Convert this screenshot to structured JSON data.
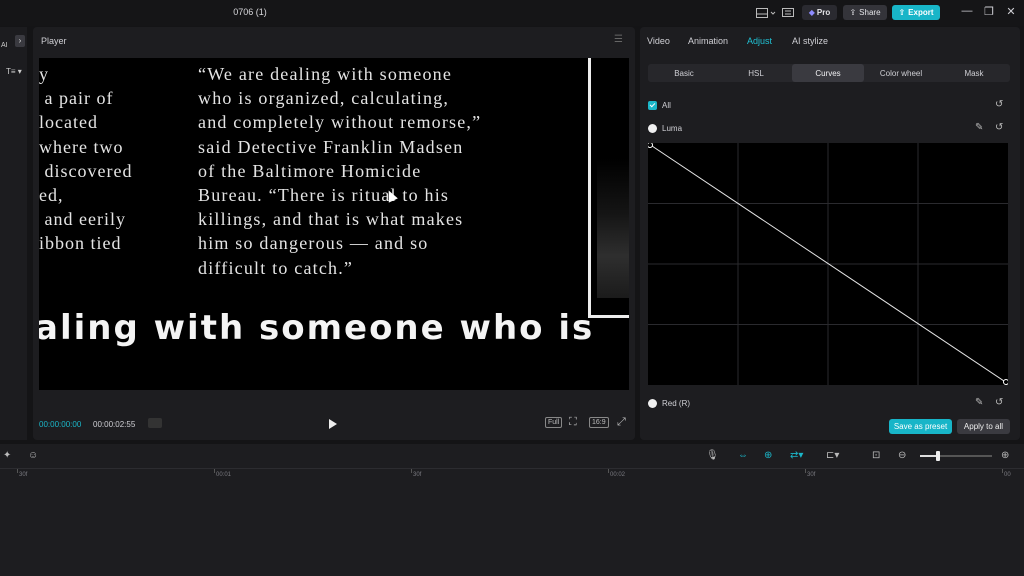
{
  "window": {
    "title": "0706 (1)",
    "pro_label": "Pro",
    "share_label": "Share",
    "export_label": "Export",
    "minimize_icon": "—",
    "restore_icon": "❐",
    "close_icon": "✕"
  },
  "left_strip": {
    "ai_label": "AI",
    "text_tool_label": "T≡ ▾",
    "expand_icon": "›"
  },
  "player": {
    "title": "Player",
    "current_time": "00:00:00:00",
    "duration": "00:00:02:55",
    "full_label": "Full",
    "ratio_label": "16:9",
    "video": {
      "left_column": "y\n a pair of\nlocated\nwhere two\n discovered\ned,\n and eerily\nibbon tied",
      "quote": "“We are dealing with someone\nwho is organized, calculating,\nand completely without remorse,”\nsaid Detective Franklin Madsen\nof the Baltimore Homicide\nBureau. “There is ritual to his\nkillings, and that is what makes\nhim so dangerous — and so\ndifficult to catch.”",
      "caption": "aling with someone who is"
    }
  },
  "adjust_panel": {
    "tabs": [
      {
        "label": "Video",
        "active": false
      },
      {
        "label": "Animation",
        "active": false
      },
      {
        "label": "Adjust",
        "active": true
      },
      {
        "label": "AI stylize",
        "active": false
      }
    ],
    "subtabs": [
      {
        "label": "Basic",
        "active": false
      },
      {
        "label": "HSL",
        "active": false
      },
      {
        "label": "Curves",
        "active": true
      },
      {
        "label": "Color wheel",
        "active": false
      },
      {
        "label": "Mask",
        "active": false
      }
    ],
    "all_label": "All",
    "luma_label": "Luma",
    "red_label": "Red (R)",
    "save_preset_label": "Save as preset",
    "apply_all_label": "Apply to all",
    "reset_icon": "↺",
    "picker_icon": "✎"
  },
  "timeline": {
    "ruler": [
      "30f",
      "00:01",
      "30f",
      "00:02",
      "30f",
      "00"
    ],
    "zoom_level": 0.25
  },
  "colors": {
    "accent": "#18b5c8",
    "panel": "#1d1d20",
    "background": "#141416"
  }
}
